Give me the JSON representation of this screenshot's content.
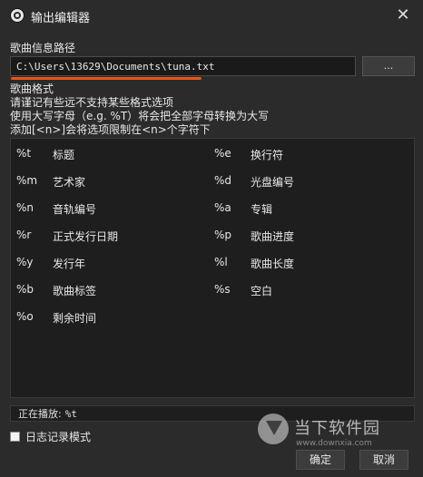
{
  "window": {
    "title": "输出编辑器"
  },
  "path_section": {
    "label": "歌曲信息路径",
    "value": "C:\\Users\\13629\\Documents\\tuna.txt",
    "browse_label": "..."
  },
  "format_section": {
    "label": "歌曲格式",
    "notes": [
      "请谨记有些远不支持某些格式选项",
      "使用大写字母（e.g. %T）将会把全部字母转换为大写",
      "添加[<n>]会将选项限制在<n>个字符下"
    ]
  },
  "formats": [
    {
      "code": "%t",
      "desc": "标题"
    },
    {
      "code": "%e",
      "desc": "换行符"
    },
    {
      "code": "%m",
      "desc": "艺术家"
    },
    {
      "code": "%d",
      "desc": "光盘编号"
    },
    {
      "code": "%n",
      "desc": "音轨编号"
    },
    {
      "code": "%a",
      "desc": "专辑"
    },
    {
      "code": "%r",
      "desc": "正式发行日期"
    },
    {
      "code": "%p",
      "desc": "歌曲进度"
    },
    {
      "code": "%y",
      "desc": "发行年"
    },
    {
      "code": "%l",
      "desc": "歌曲长度"
    },
    {
      "code": "%b",
      "desc": "歌曲标签"
    },
    {
      "code": "%s",
      "desc": "空白"
    },
    {
      "code": "%o",
      "desc": "剩余时间"
    }
  ],
  "now_playing": {
    "label": "正在播放:",
    "value": "%t"
  },
  "log_mode": {
    "label": "日志记录模式",
    "checked": false
  },
  "buttons": {
    "ok": "确定",
    "cancel": "取消"
  },
  "watermark": {
    "text": "当下软件园",
    "url": "www.downxia.com"
  },
  "colors": {
    "accent_underline": "#e8561a",
    "background": "#2b2b2b",
    "panel": "#1e1e1e"
  }
}
